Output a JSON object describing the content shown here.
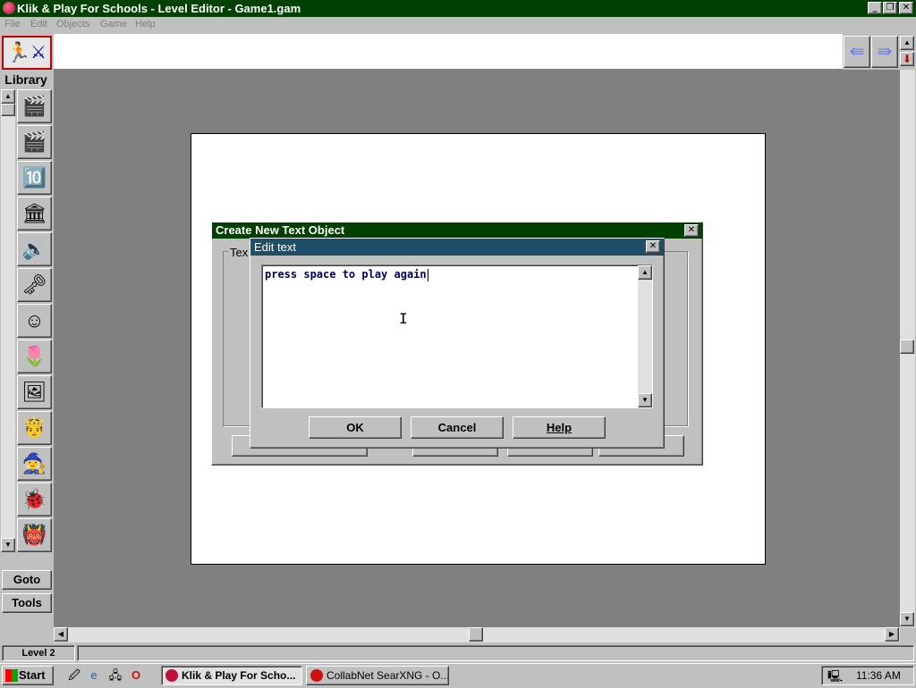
{
  "window": {
    "title": "Klik & Play For Schools - Level Editor - Game1.gam",
    "controls": {
      "minimize": "_",
      "restore": "❐",
      "close": "✕"
    }
  },
  "menu": [
    "File",
    "Edit",
    "Objects",
    "Game",
    "Help"
  ],
  "sidebar": {
    "library_label": "Library",
    "goto_label": "Goto",
    "tools_label": "Tools",
    "library_icons": [
      "clapper-icon",
      "clapper-icon",
      "scoreboard-icon",
      "building-icon",
      "speaker-icon",
      "key-icon",
      "face-icon",
      "flower-icon",
      "portrait-icon",
      "king-icon",
      "witch-icon",
      "bug-icon",
      "monster-icon"
    ]
  },
  "status": {
    "level": "Level 2"
  },
  "dialog_back": {
    "title": "Create New Text Object",
    "group_label": "Tex"
  },
  "dialog_edit": {
    "title": "Edit text",
    "text_value": "press space to play again",
    "ok_label": "OK",
    "cancel_label": "Cancel",
    "help_label": "Help"
  },
  "taskbar": {
    "start_label": "Start",
    "tasks": [
      {
        "label": "Klik & Play For Scho...",
        "active": true,
        "icon_color": "#c0103a"
      },
      {
        "label": "CollabNet SearXNG - O...",
        "active": false,
        "icon_color": "#d01010"
      }
    ],
    "clock": "11:36 AM"
  },
  "colors": {
    "title_active": "#004000",
    "dialog_title": "#1e4e68",
    "workspace": "#808080",
    "level_frame": "#ffffff",
    "text_color": "#000060"
  }
}
